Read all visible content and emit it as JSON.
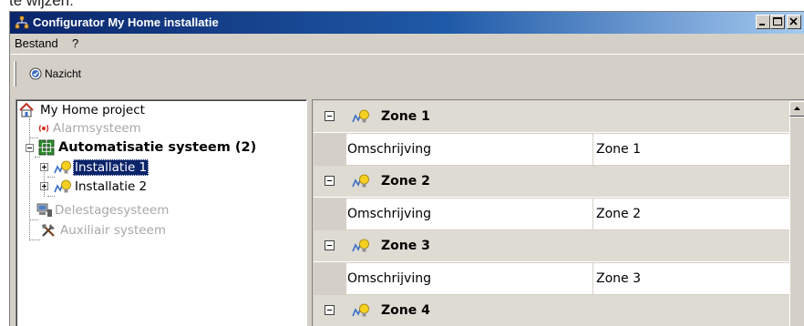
{
  "top_fragment": "te wijzen:",
  "window": {
    "title": "Configurator My Home installatie",
    "icon": "network-app-icon",
    "buttons": [
      "minimize",
      "maximize",
      "close"
    ]
  },
  "menu": [
    "Bestand",
    "?"
  ],
  "toolbar": {
    "button_label": "Nazicht",
    "button_icon": "check-circle-icon"
  },
  "tree": {
    "root": {
      "label": "My Home project",
      "icon": "house-icon"
    },
    "items": [
      {
        "label": "Alarmsysteem",
        "icon": "alarm-signal-icon",
        "enabled": false
      },
      {
        "label": "Automatisatie systeem (2)",
        "icon": "automation-grid-icon",
        "enabled": true,
        "expanded": true,
        "children": [
          {
            "label": "Installatie 1",
            "icon": "light-bulb-icon",
            "selected": true
          },
          {
            "label": "Installatie 2",
            "icon": "light-bulb-icon",
            "selected": false
          }
        ]
      },
      {
        "label": "Delestagesysteem",
        "icon": "computer-load-icon",
        "enabled": false
      },
      {
        "label": "Auxiliair systeem",
        "icon": "tools-icon",
        "enabled": false
      }
    ]
  },
  "zones": [
    {
      "name": "Zone 1",
      "property": "Omschrijving",
      "value": "Zone 1"
    },
    {
      "name": "Zone 2",
      "property": "Omschrijving",
      "value": "Zone 2"
    },
    {
      "name": "Zone 3",
      "property": "Omschrijving",
      "value": "Zone 3"
    },
    {
      "name": "Zone 4"
    }
  ],
  "colors": {
    "title_gradient_start": "#0a246a",
    "title_gradient_end": "#a6caf0",
    "selection": "#0a246a",
    "window_face": "#d4d0c8",
    "disabled_text": "#a8a8a8"
  }
}
